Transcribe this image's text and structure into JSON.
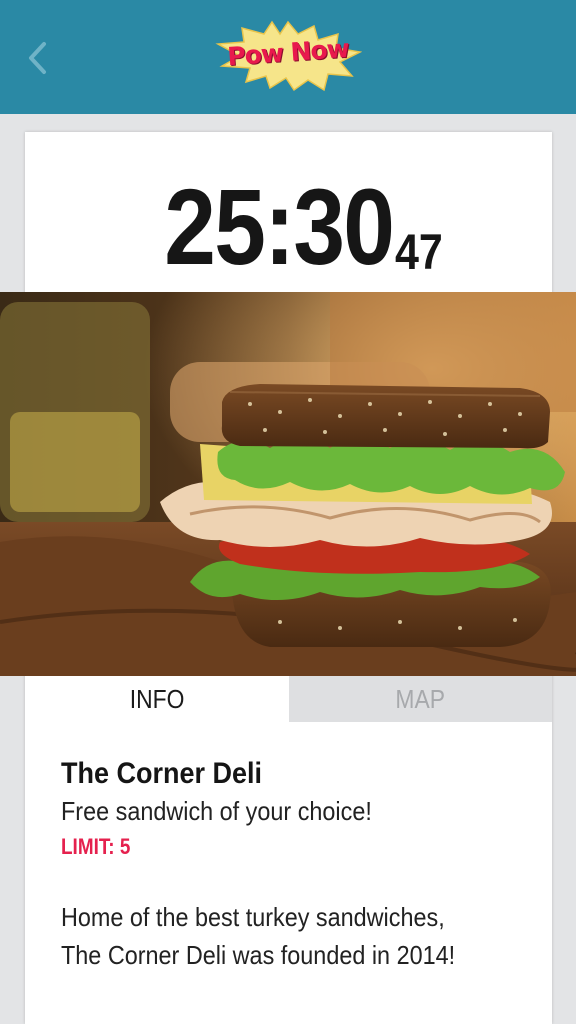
{
  "header": {
    "logo_text": "Pow Now",
    "back_icon": "chevron-left-icon",
    "colors": {
      "bar": "#2a89a5",
      "logo_burst": "#f6e58a",
      "logo_text": "#e8194d"
    }
  },
  "timer": {
    "main": "25:30",
    "seconds": "47"
  },
  "photo": {
    "subject": "sandwich-photo"
  },
  "tabs": [
    {
      "label": "INFO",
      "active": true
    },
    {
      "label": "MAP",
      "active": false
    }
  ],
  "deal": {
    "name": "The Corner Deli",
    "offer": "Free sandwich of your choice!",
    "limit": "LIMIT: 5",
    "description_lines": [
      "Home of the best turkey sandwiches,",
      "The Corner Deli was founded in 2014!"
    ],
    "accent_color": "#e5214e"
  }
}
